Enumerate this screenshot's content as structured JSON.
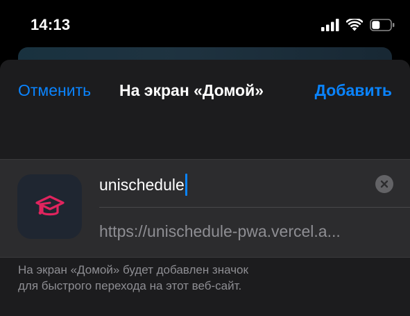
{
  "status_bar": {
    "time": "14:13",
    "icons": [
      "cellular-signal-icon",
      "wifi-icon",
      "battery-icon"
    ]
  },
  "sheet": {
    "cancel_label": "Отменить",
    "title": "На экран «Домой»",
    "add_label": "Добавить",
    "app_icon": "graduation-cap-icon",
    "name_value": "unischedule",
    "url_value": "https://unischedule-pwa.vercel.a...",
    "footnote_line1": "На экран «Домой» будет добавлен значок",
    "footnote_line2": "для быстрого перехода на этот веб-сайт."
  },
  "colors": {
    "accent": "#0a84ff",
    "sheet_background": "#1c1c1e",
    "group_background": "#2c2c2e",
    "secondary_text": "#8e8e93",
    "icon_pink": "#e0245e",
    "icon_background": "#1f2631"
  }
}
